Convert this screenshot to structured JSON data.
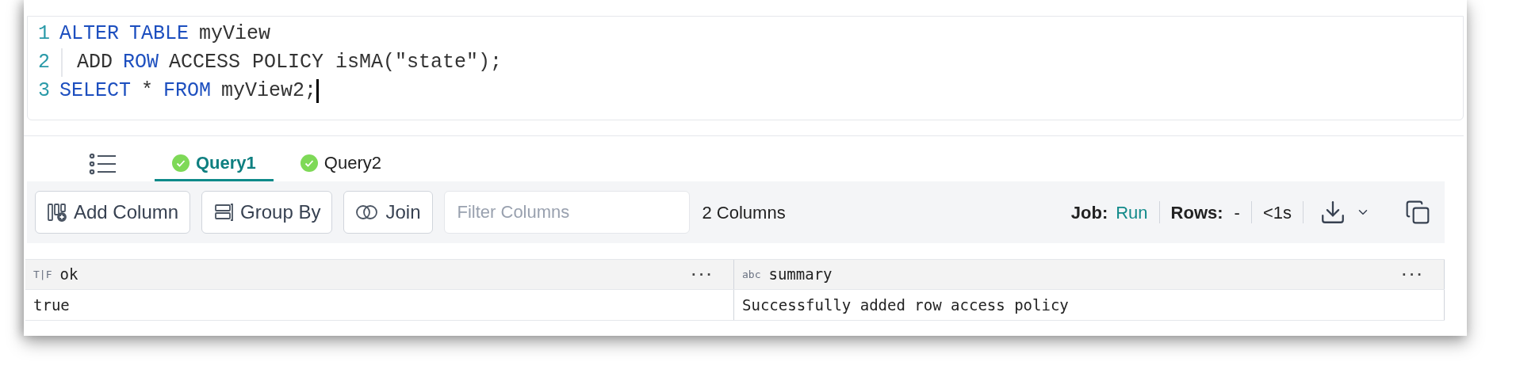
{
  "editor": {
    "lines": [
      {
        "number": "1",
        "indented": false,
        "tokens": [
          {
            "kind": "keyword",
            "text": "ALTER"
          },
          {
            "kind": "keyword",
            "text": "TABLE"
          },
          {
            "kind": "plain",
            "text": "myView"
          }
        ]
      },
      {
        "number": "2",
        "indented": true,
        "tokens": [
          {
            "kind": "plain",
            "text": "ADD"
          },
          {
            "kind": "keyword",
            "text": "ROW"
          },
          {
            "kind": "plain",
            "text": "ACCESS POLICY isMA(\"state\");"
          }
        ]
      },
      {
        "number": "3",
        "indented": false,
        "cursor": true,
        "tokens": [
          {
            "kind": "keyword",
            "text": "SELECT"
          },
          {
            "kind": "plain",
            "text": "*"
          },
          {
            "kind": "keyword",
            "text": "FROM"
          },
          {
            "kind": "plain",
            "text": "myView2;"
          }
        ]
      }
    ]
  },
  "tabs": [
    {
      "label": "Query1",
      "selected": true,
      "ok": true
    },
    {
      "label": "Query2",
      "selected": false,
      "ok": true
    }
  ],
  "toolbar": {
    "buttons": [
      {
        "kind": "add-column",
        "label": "Add Column"
      },
      {
        "kind": "group-by",
        "label": "Group By"
      },
      {
        "kind": "join",
        "label": "Join"
      }
    ],
    "filter": {
      "placeholder": "Filter Columns"
    },
    "column_count": "2 Columns",
    "job_label": "Job:",
    "job_value": "Run",
    "rows_label": "Rows:",
    "rows_value": "-",
    "duration": "<1s"
  },
  "table": {
    "columns": [
      {
        "type": "T|F",
        "name": "ok",
        "menu": "···"
      },
      {
        "type": "abc",
        "name": "summary",
        "menu": "···"
      }
    ],
    "rows": [
      [
        "true",
        "Successfully added row access policy"
      ]
    ]
  }
}
